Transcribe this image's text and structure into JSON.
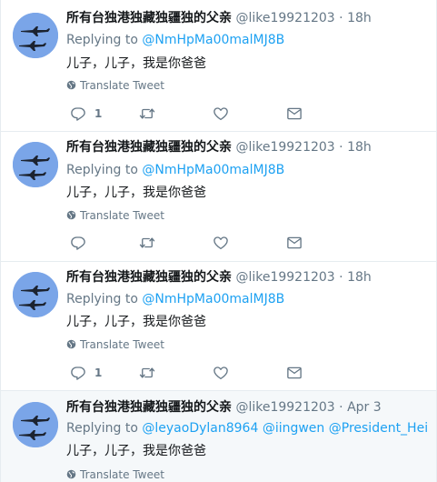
{
  "colors": {
    "link": "#1da1f2",
    "muted": "#657786",
    "text": "#14171a",
    "avatar_bg": "#7aa5e8"
  },
  "icons": {
    "reply": "reply-icon",
    "retweet": "retweet-icon",
    "like": "heart-icon",
    "dm": "envelope-icon",
    "translate": "globe-icon"
  },
  "tweets": [
    {
      "name": "所有台独港独藏独疆独的父亲",
      "handle": "@like19921203",
      "time": "18h",
      "replying_label": "Replying to",
      "mentions": [
        "@NmHpMa00malMJ8B"
      ],
      "text": "儿子，儿子，我是你爸爸",
      "translate": "Translate Tweet",
      "reply_count": "1"
    },
    {
      "name": "所有台独港独藏独疆独的父亲",
      "handle": "@like19921203",
      "time": "18h",
      "replying_label": "Replying to",
      "mentions": [
        "@NmHpMa00malMJ8B"
      ],
      "text": "儿子，儿子，我是你爸爸",
      "translate": "Translate Tweet",
      "reply_count": ""
    },
    {
      "name": "所有台独港独藏独疆独的父亲",
      "handle": "@like19921203",
      "time": "18h",
      "replying_label": "Replying to",
      "mentions": [
        "@NmHpMa00malMJ8B"
      ],
      "text": "儿子，儿子，我是你爸爸",
      "translate": "Translate Tweet",
      "reply_count": "1"
    },
    {
      "name": "所有台独港独藏独疆独的父亲",
      "handle": "@like19921203",
      "time": "Apr 3",
      "replying_label": "Replying to",
      "mentions": [
        "@leyaoDylan8964",
        "@iingwen",
        "@President_Heine"
      ],
      "text": "儿子，儿子，我是你爸爸",
      "translate": "Translate Tweet",
      "reply_count": ""
    }
  ],
  "separator": "·"
}
